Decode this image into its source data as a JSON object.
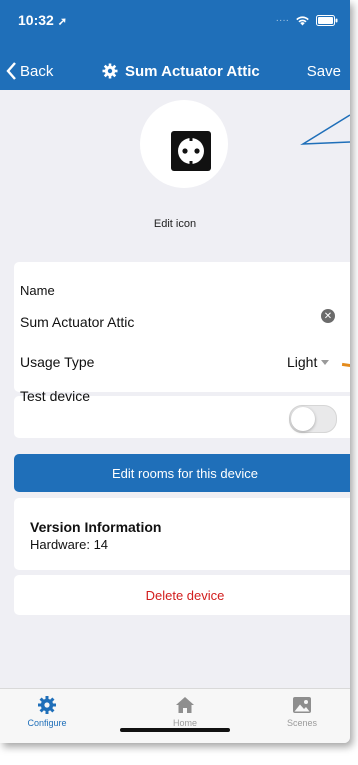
{
  "status_bar": {
    "time": "10:32"
  },
  "nav": {
    "back_label": "Back",
    "title": "Sum Actuator Attic",
    "save_label": "Save"
  },
  "device_icon": {
    "edit_label": "Edit icon",
    "icon_name": "power-socket-icon"
  },
  "form": {
    "name_label": "Name",
    "name_value": "Sum Actuator Attic",
    "usage_label": "Usage Type",
    "usage_value": "Light"
  },
  "test_device": {
    "label": "Test device",
    "enabled": false
  },
  "rooms_button": {
    "label": "Edit rooms for this device"
  },
  "version": {
    "title": "Version Information",
    "hardware": "Hardware: 14"
  },
  "delete_button": {
    "label": "Delete device"
  },
  "tabs": [
    {
      "label": "Configure",
      "icon": "gear-icon",
      "active": true
    },
    {
      "label": "Home",
      "icon": "home-icon",
      "active": false
    },
    {
      "label": "Scenes",
      "icon": "scenes-icon",
      "active": false
    }
  ],
  "colors": {
    "accent": "#1f6fb9",
    "danger": "#d21d1d",
    "background": "#efeff4"
  }
}
